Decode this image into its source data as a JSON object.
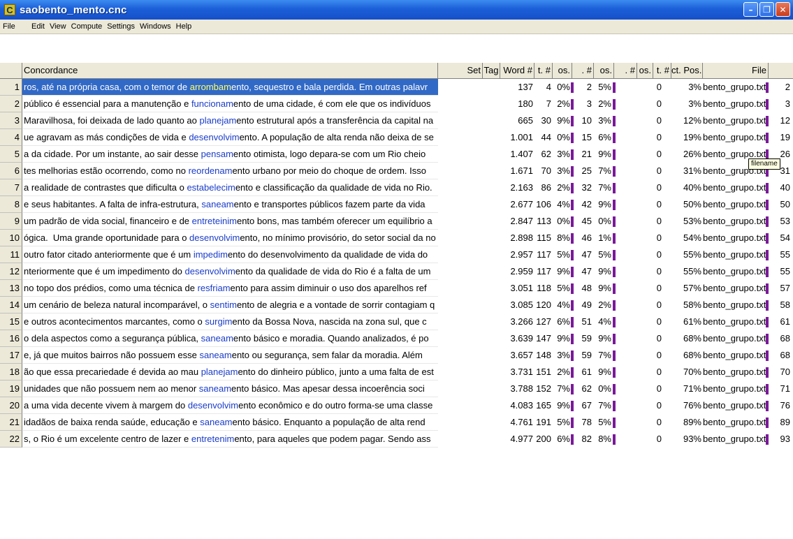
{
  "window": {
    "title": "saobento_mento.cnc",
    "app_icon_letter": "C"
  },
  "menu": [
    "File",
    "Edit",
    "View",
    "Compute",
    "Settings",
    "Windows",
    "Help"
  ],
  "columns": [
    "Concordance",
    "Set",
    "Tag",
    "Word #",
    "t. #",
    "os.",
    ". #",
    "os.",
    ". #",
    "os.",
    "t. #",
    "ct. Pos.",
    "File"
  ],
  "tooltip": "filename",
  "colors": {
    "selection": "#3169c6",
    "keyword": "#1a3cc8",
    "bar": "#7a1a99",
    "titlebar": "#1c5fd8"
  },
  "rows": [
    {
      "n": "1",
      "pre": "ros, até na própria casa, com o temor de ",
      "kw": "arrombam",
      "post": "ento, sequestro e bala perdida. Em outras palavr",
      "word": "137",
      "t": "4",
      "os": "0%",
      "h": "2",
      "os2": "5%",
      "z": "0",
      "pos": "3%",
      "file": "bento_grupo.txt",
      "last": "2",
      "selected": true
    },
    {
      "n": "2",
      "pre": "público é essencial para a manutenção e ",
      "kw": "funcionam",
      "post": "ento de uma cidade, é com ele que os indivíduos",
      "word": "180",
      "t": "7",
      "os": "2%",
      "h": "3",
      "os2": "2%",
      "z": "0",
      "pos": "3%",
      "file": "bento_grupo.txt",
      "last": "3"
    },
    {
      "n": "3",
      "pre": "Maravilhosa, foi deixada de lado quanto ao ",
      "kw": "planejam",
      "post": "ento estrutural após a transferência da capital na",
      "word": "665",
      "t": "30",
      "os": "9%",
      "h": "10",
      "os2": "3%",
      "z": "0",
      "pos": "12%",
      "file": "bento_grupo.txt",
      "last": "12"
    },
    {
      "n": "4",
      "pre": "ue agravam as más condições de vida e ",
      "kw": "desenvolvim",
      "post": "ento. A população de alta renda não deixa de se",
      "word": "1.001",
      "t": "44",
      "os": "0%",
      "h": "15",
      "os2": "6%",
      "z": "0",
      "pos": "19%",
      "file": "bento_grupo.txt",
      "last": "19"
    },
    {
      "n": "5",
      "pre": "a da cidade. Por um instante, ao sair desse ",
      "kw": "pensam",
      "post": "ento otimista, logo depara-se com um Rio cheio",
      "word": "1.407",
      "t": "62",
      "os": "3%",
      "h": "21",
      "os2": "9%",
      "z": "0",
      "pos": "26%",
      "file": "bento_grupo.txt",
      "last": "26"
    },
    {
      "n": "6",
      "pre": "tes melhorias estão ocorrendo, como no ",
      "kw": "reordenam",
      "post": "ento urbano por meio do choque de ordem. Isso",
      "word": "1.671",
      "t": "70",
      "os": "3%",
      "h": "25",
      "os2": "7%",
      "z": "0",
      "pos": "31%",
      "file": "bento_grupo.txt",
      "last": "31"
    },
    {
      "n": "7",
      "pre": "a realidade de contrastes que dificulta o ",
      "kw": "estabelecim",
      "post": "ento e classificação da qualidade de vida no Rio.",
      "word": "2.163",
      "t": "86",
      "os": "2%",
      "h": "32",
      "os2": "7%",
      "z": "0",
      "pos": "40%",
      "file": "bento_grupo.txt",
      "last": "40"
    },
    {
      "n": "8",
      "pre": "e seus habitantes. A falta de infra-estrutura, ",
      "kw": "saneam",
      "post": "ento e transportes públicos fazem parte da vida",
      "word": "2.677",
      "t": "106",
      "os": "4%",
      "h": "42",
      "os2": "9%",
      "z": "0",
      "pos": "50%",
      "file": "bento_grupo.txt",
      "last": "50"
    },
    {
      "n": "9",
      "pre": "um padrão de vida social, financeiro e de ",
      "kw": "entreteinim",
      "post": "ento bons, mas também oferecer um equilíbrio a",
      "word": "2.847",
      "t": "113",
      "os": "0%",
      "h": "45",
      "os2": "0%",
      "z": "0",
      "pos": "53%",
      "file": "bento_grupo.txt",
      "last": "53"
    },
    {
      "n": "10",
      "pre": "ógica.  Uma grande oportunidade para o ",
      "kw": "desenvolvim",
      "post": "ento, no mínimo provisório, do setor social da no",
      "word": "2.898",
      "t": "115",
      "os": "8%",
      "h": "46",
      "os2": "1%",
      "z": "0",
      "pos": "54%",
      "file": "bento_grupo.txt",
      "last": "54"
    },
    {
      "n": "11",
      "pre": "outro fator citado anteriormente que é um ",
      "kw": "impedim",
      "post": "ento do desenvolvimento da qualidade de vida do",
      "word": "2.957",
      "t": "117",
      "os": "5%",
      "h": "47",
      "os2": "5%",
      "z": "0",
      "pos": "55%",
      "file": "bento_grupo.txt",
      "last": "55"
    },
    {
      "n": "12",
      "pre": "nteriormente que é um impedimento do ",
      "kw": "desenvolvim",
      "post": "ento da qualidade de vida do Rio é a falta de um",
      "word": "2.959",
      "t": "117",
      "os": "9%",
      "h": "47",
      "os2": "9%",
      "z": "0",
      "pos": "55%",
      "file": "bento_grupo.txt",
      "last": "55"
    },
    {
      "n": "13",
      "pre": "no topo dos prédios, como uma técnica de ",
      "kw": "resfriam",
      "post": "ento para assim diminuir o uso dos aparelhos ref",
      "word": "3.051",
      "t": "118",
      "os": "5%",
      "h": "48",
      "os2": "9%",
      "z": "0",
      "pos": "57%",
      "file": "bento_grupo.txt",
      "last": "57"
    },
    {
      "n": "14",
      "pre": "um cenário de beleza natural incomparável, o ",
      "kw": "sentim",
      "post": "ento de alegria e a vontade de sorrir contagiam q",
      "word": "3.085",
      "t": "120",
      "os": "4%",
      "h": "49",
      "os2": "2%",
      "z": "0",
      "pos": "58%",
      "file": "bento_grupo.txt",
      "last": "58"
    },
    {
      "n": "15",
      "pre": "e outros acontecimentos marcantes, como o ",
      "kw": "surgim",
      "post": "ento da Bossa Nova, nascida na zona sul, que c",
      "word": "3.266",
      "t": "127",
      "os": "6%",
      "h": "51",
      "os2": "4%",
      "z": "0",
      "pos": "61%",
      "file": "bento_grupo.txt",
      "last": "61"
    },
    {
      "n": "16",
      "pre": "o dela aspectos como a segurança pública, ",
      "kw": "saneam",
      "post": "ento básico e moradia. Quando analizados, é po",
      "word": "3.639",
      "t": "147",
      "os": "9%",
      "h": "59",
      "os2": "9%",
      "z": "0",
      "pos": "68%",
      "file": "bento_grupo.txt",
      "last": "68"
    },
    {
      "n": "17",
      "pre": "e, já que muitos bairros não possuem esse ",
      "kw": "saneam",
      "post": "ento ou segurança, sem falar da moradia. Além",
      "word": "3.657",
      "t": "148",
      "os": "3%",
      "h": "59",
      "os2": "7%",
      "z": "0",
      "pos": "68%",
      "file": "bento_grupo.txt",
      "last": "68"
    },
    {
      "n": "18",
      "pre": "ão que essa precariedade é devida ao mau ",
      "kw": "planejam",
      "post": "ento do dinheiro público, junto a uma falta de est",
      "word": "3.731",
      "t": "151",
      "os": "2%",
      "h": "61",
      "os2": "9%",
      "z": "0",
      "pos": "70%",
      "file": "bento_grupo.txt",
      "last": "70"
    },
    {
      "n": "19",
      "pre": "unidades que não possuem nem ao menor ",
      "kw": "saneam",
      "post": "ento básico. Mas apesar dessa incoerência soci",
      "word": "3.788",
      "t": "152",
      "os": "7%",
      "h": "62",
      "os2": "0%",
      "z": "0",
      "pos": "71%",
      "file": "bento_grupo.txt",
      "last": "71"
    },
    {
      "n": "20",
      "pre": "a uma vida decente vivem à margem do ",
      "kw": "desenvolvim",
      "post": "ento econômico e do outro forma-se uma classe",
      "word": "4.083",
      "t": "165",
      "os": "9%",
      "h": "67",
      "os2": "7%",
      "z": "0",
      "pos": "76%",
      "file": "bento_grupo.txt",
      "last": "76"
    },
    {
      "n": "21",
      "pre": "idadãos de baixa renda saúde, educação e ",
      "kw": "saneam",
      "post": "ento básico. Enquanto a população de alta rend",
      "word": "4.761",
      "t": "191",
      "os": "5%",
      "h": "78",
      "os2": "5%",
      "z": "0",
      "pos": "89%",
      "file": "bento_grupo.txt",
      "last": "89"
    },
    {
      "n": "22",
      "pre": "s, o Rio é um excelente centro de lazer e ",
      "kw": "entretenim",
      "post": "ento, para aqueles que podem pagar. Sendo ass",
      "word": "4.977",
      "t": "200",
      "os": "6%",
      "h": "82",
      "os2": "8%",
      "z": "0",
      "pos": "93%",
      "file": "bento_grupo.txt",
      "last": "93"
    }
  ]
}
